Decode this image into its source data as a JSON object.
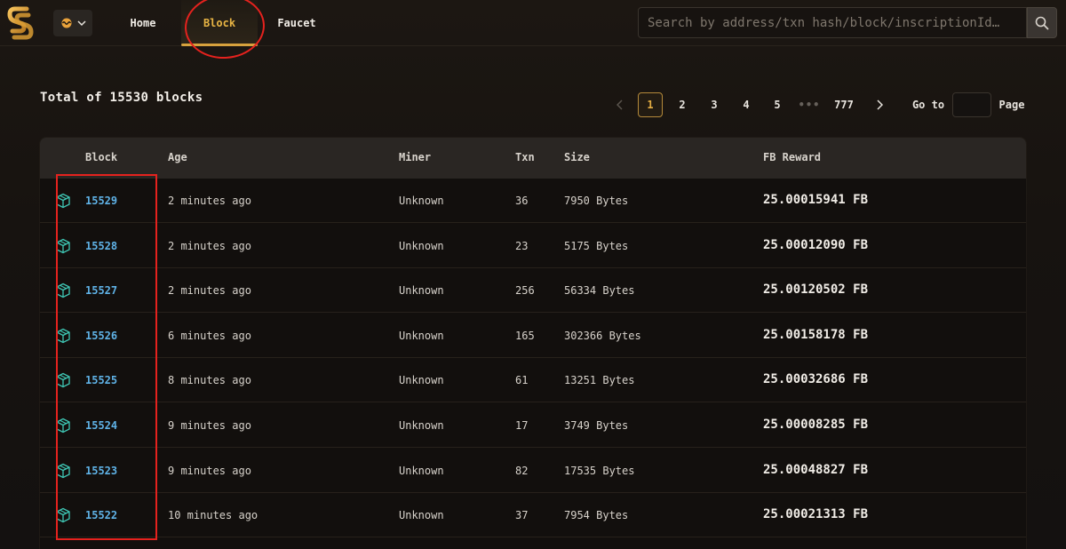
{
  "header": {
    "nav": [
      {
        "label": "Home"
      },
      {
        "label": "Block"
      },
      {
        "label": "Faucet"
      }
    ],
    "search_placeholder": "Search by address/txn hash/block/inscriptionId…"
  },
  "title": "Total of 15530 blocks",
  "pagination": {
    "pages": [
      "1",
      "2",
      "3",
      "4",
      "5",
      "•••",
      "777"
    ],
    "current": "1",
    "goto_label": "Go to",
    "page_label": "Page",
    "goto_value": ""
  },
  "table": {
    "columns": [
      "Block",
      "Age",
      "Miner",
      "Txn",
      "Size",
      "FB Reward"
    ],
    "rows": [
      {
        "block": "15529",
        "age": "2 minutes ago",
        "miner": "Unknown",
        "txn": "36",
        "size": "7950 Bytes",
        "reward": "25.00015941 FB"
      },
      {
        "block": "15528",
        "age": "2 minutes ago",
        "miner": "Unknown",
        "txn": "23",
        "size": "5175 Bytes",
        "reward": "25.00012090 FB"
      },
      {
        "block": "15527",
        "age": "2 minutes ago",
        "miner": "Unknown",
        "txn": "256",
        "size": "56334 Bytes",
        "reward": "25.00120502 FB"
      },
      {
        "block": "15526",
        "age": "6 minutes ago",
        "miner": "Unknown",
        "txn": "165",
        "size": "302366 Bytes",
        "reward": "25.00158178 FB"
      },
      {
        "block": "15525",
        "age": "8 minutes ago",
        "miner": "Unknown",
        "txn": "61",
        "size": "13251 Bytes",
        "reward": "25.00032686 FB"
      },
      {
        "block": "15524",
        "age": "9 minutes ago",
        "miner": "Unknown",
        "txn": "17",
        "size": "3749 Bytes",
        "reward": "25.00008285 FB"
      },
      {
        "block": "15523",
        "age": "9 minutes ago",
        "miner": "Unknown",
        "txn": "82",
        "size": "17535 Bytes",
        "reward": "25.00048827 FB"
      },
      {
        "block": "15522",
        "age": "10 minutes ago",
        "miner": "Unknown",
        "txn": "37",
        "size": "7954 Bytes",
        "reward": "25.00021313 FB"
      }
    ]
  },
  "icons": {
    "logo": "logo-icon",
    "network": "network-icon",
    "chevron": "chevron-down-icon",
    "search": "search-icon",
    "row": "cube-icon"
  },
  "colors": {
    "accent": "#e9b544",
    "link": "#5fb2e6",
    "cube": "#3fc7b4",
    "annotation": "#e5221e"
  }
}
